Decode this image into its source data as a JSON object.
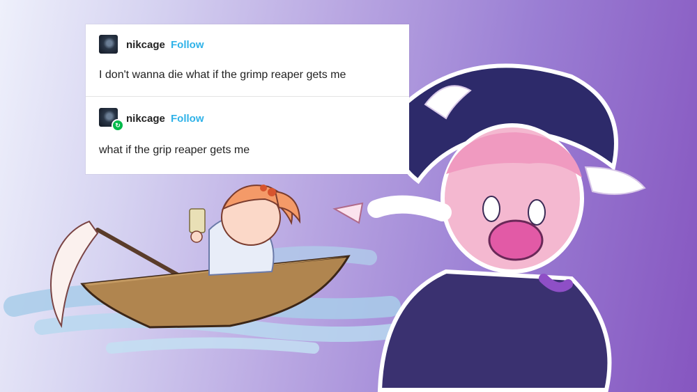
{
  "post_1": {
    "username": "nikcage",
    "follow_label": "Follow",
    "text": "I don't wanna die what if the grimp reaper gets me"
  },
  "post_2": {
    "username": "nikcage",
    "follow_label": "Follow",
    "text": "what if the grip reaper gets me",
    "reblog_icon": "reblog-icon"
  },
  "colors": {
    "follow_link": "#2fb2e8",
    "reblog_badge": "#00b94a",
    "background_left": "#eef0fb",
    "background_right": "#8656c0"
  }
}
